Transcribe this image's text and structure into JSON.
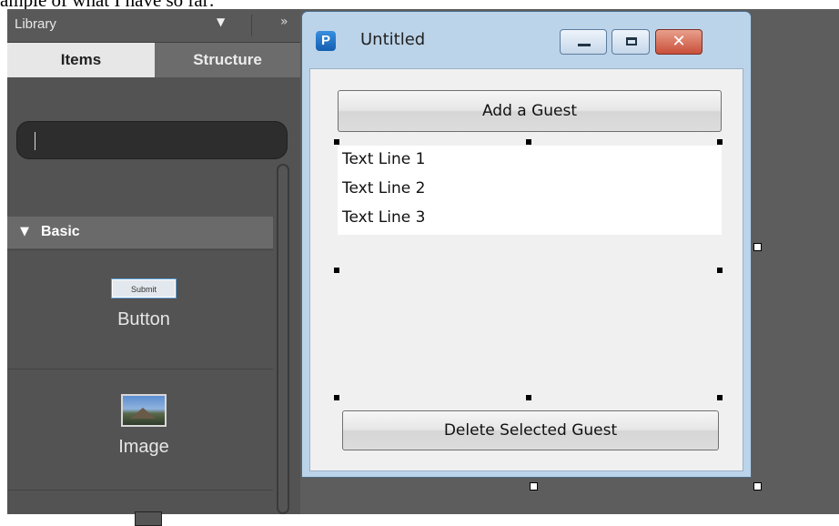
{
  "caption": "ample of what I have so far:",
  "library": {
    "title": "Library",
    "dropdown_icon": "triangle-down-icon",
    "more_icon": "double-chevron-right-icon",
    "tabs": [
      {
        "label": "Items",
        "active": true
      },
      {
        "label": "Structure",
        "active": false
      }
    ],
    "search": {
      "value": "",
      "placeholder": ""
    },
    "section": {
      "label": "Basic",
      "expanded": true
    },
    "items": [
      {
        "label": "Button",
        "thumb_label": "Submit"
      },
      {
        "label": "Image"
      }
    ]
  },
  "window": {
    "title": "Untitled",
    "app_icon_letter": "P",
    "controls": [
      "minimize",
      "maximize",
      "close"
    ],
    "add_button": "Add a Guest",
    "list_items": [
      "Text Line 1",
      "Text Line 2",
      "Text Line 3"
    ],
    "delete_button": "Delete Selected Guest"
  },
  "colors": {
    "canvas": "#5d5d5d",
    "panel": "#535353",
    "active_tab": "#e7e7e7",
    "window_frame": "#bcd4ea",
    "close_button": "#c94f3a"
  }
}
